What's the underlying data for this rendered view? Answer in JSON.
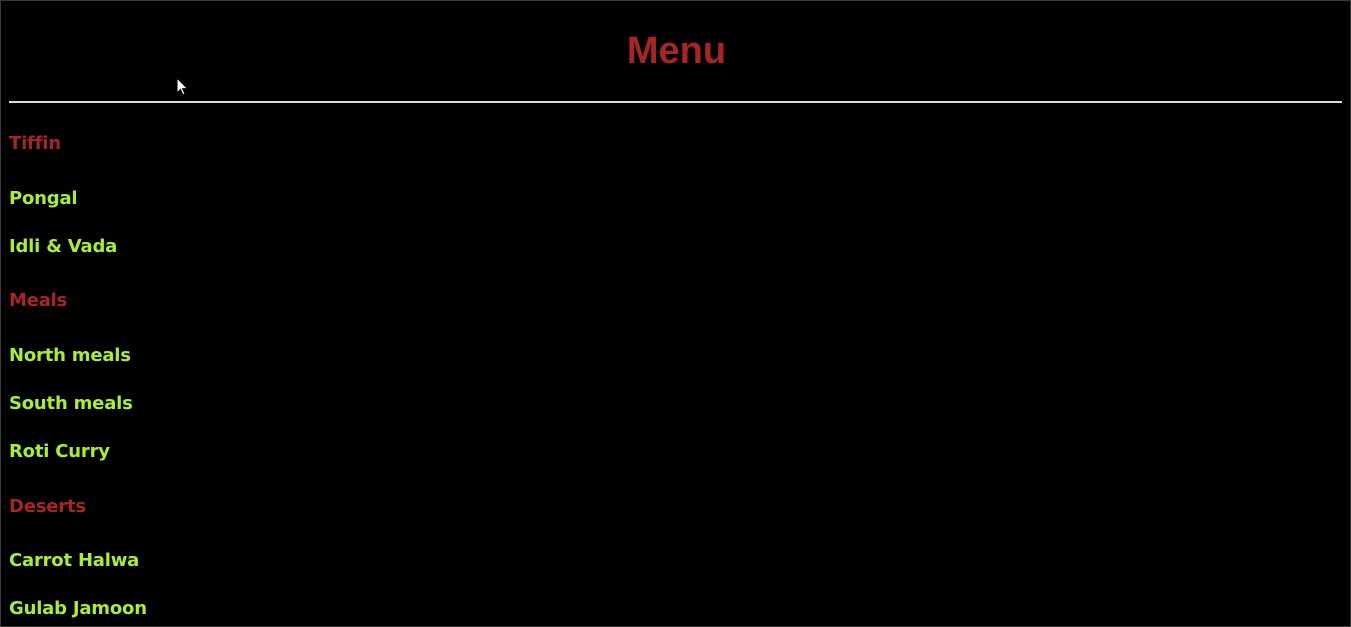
{
  "page": {
    "title": "Menu"
  },
  "colors": {
    "background": "#000000",
    "title": "#a82525",
    "section_heading": "#a82525",
    "item": "#a8ee38",
    "divider": "#d9d9d9"
  },
  "menu": {
    "sections": [
      {
        "heading": "Tiffin",
        "items": [
          "Pongal",
          "Idli & Vada"
        ]
      },
      {
        "heading": "Meals",
        "items": [
          "North meals",
          "South meals",
          "Roti Curry"
        ]
      },
      {
        "heading": "Deserts",
        "items": [
          "Carrot Halwa",
          "Gulab Jamoon"
        ]
      }
    ]
  },
  "cursor": {
    "icon": "arrow-cursor-icon"
  }
}
